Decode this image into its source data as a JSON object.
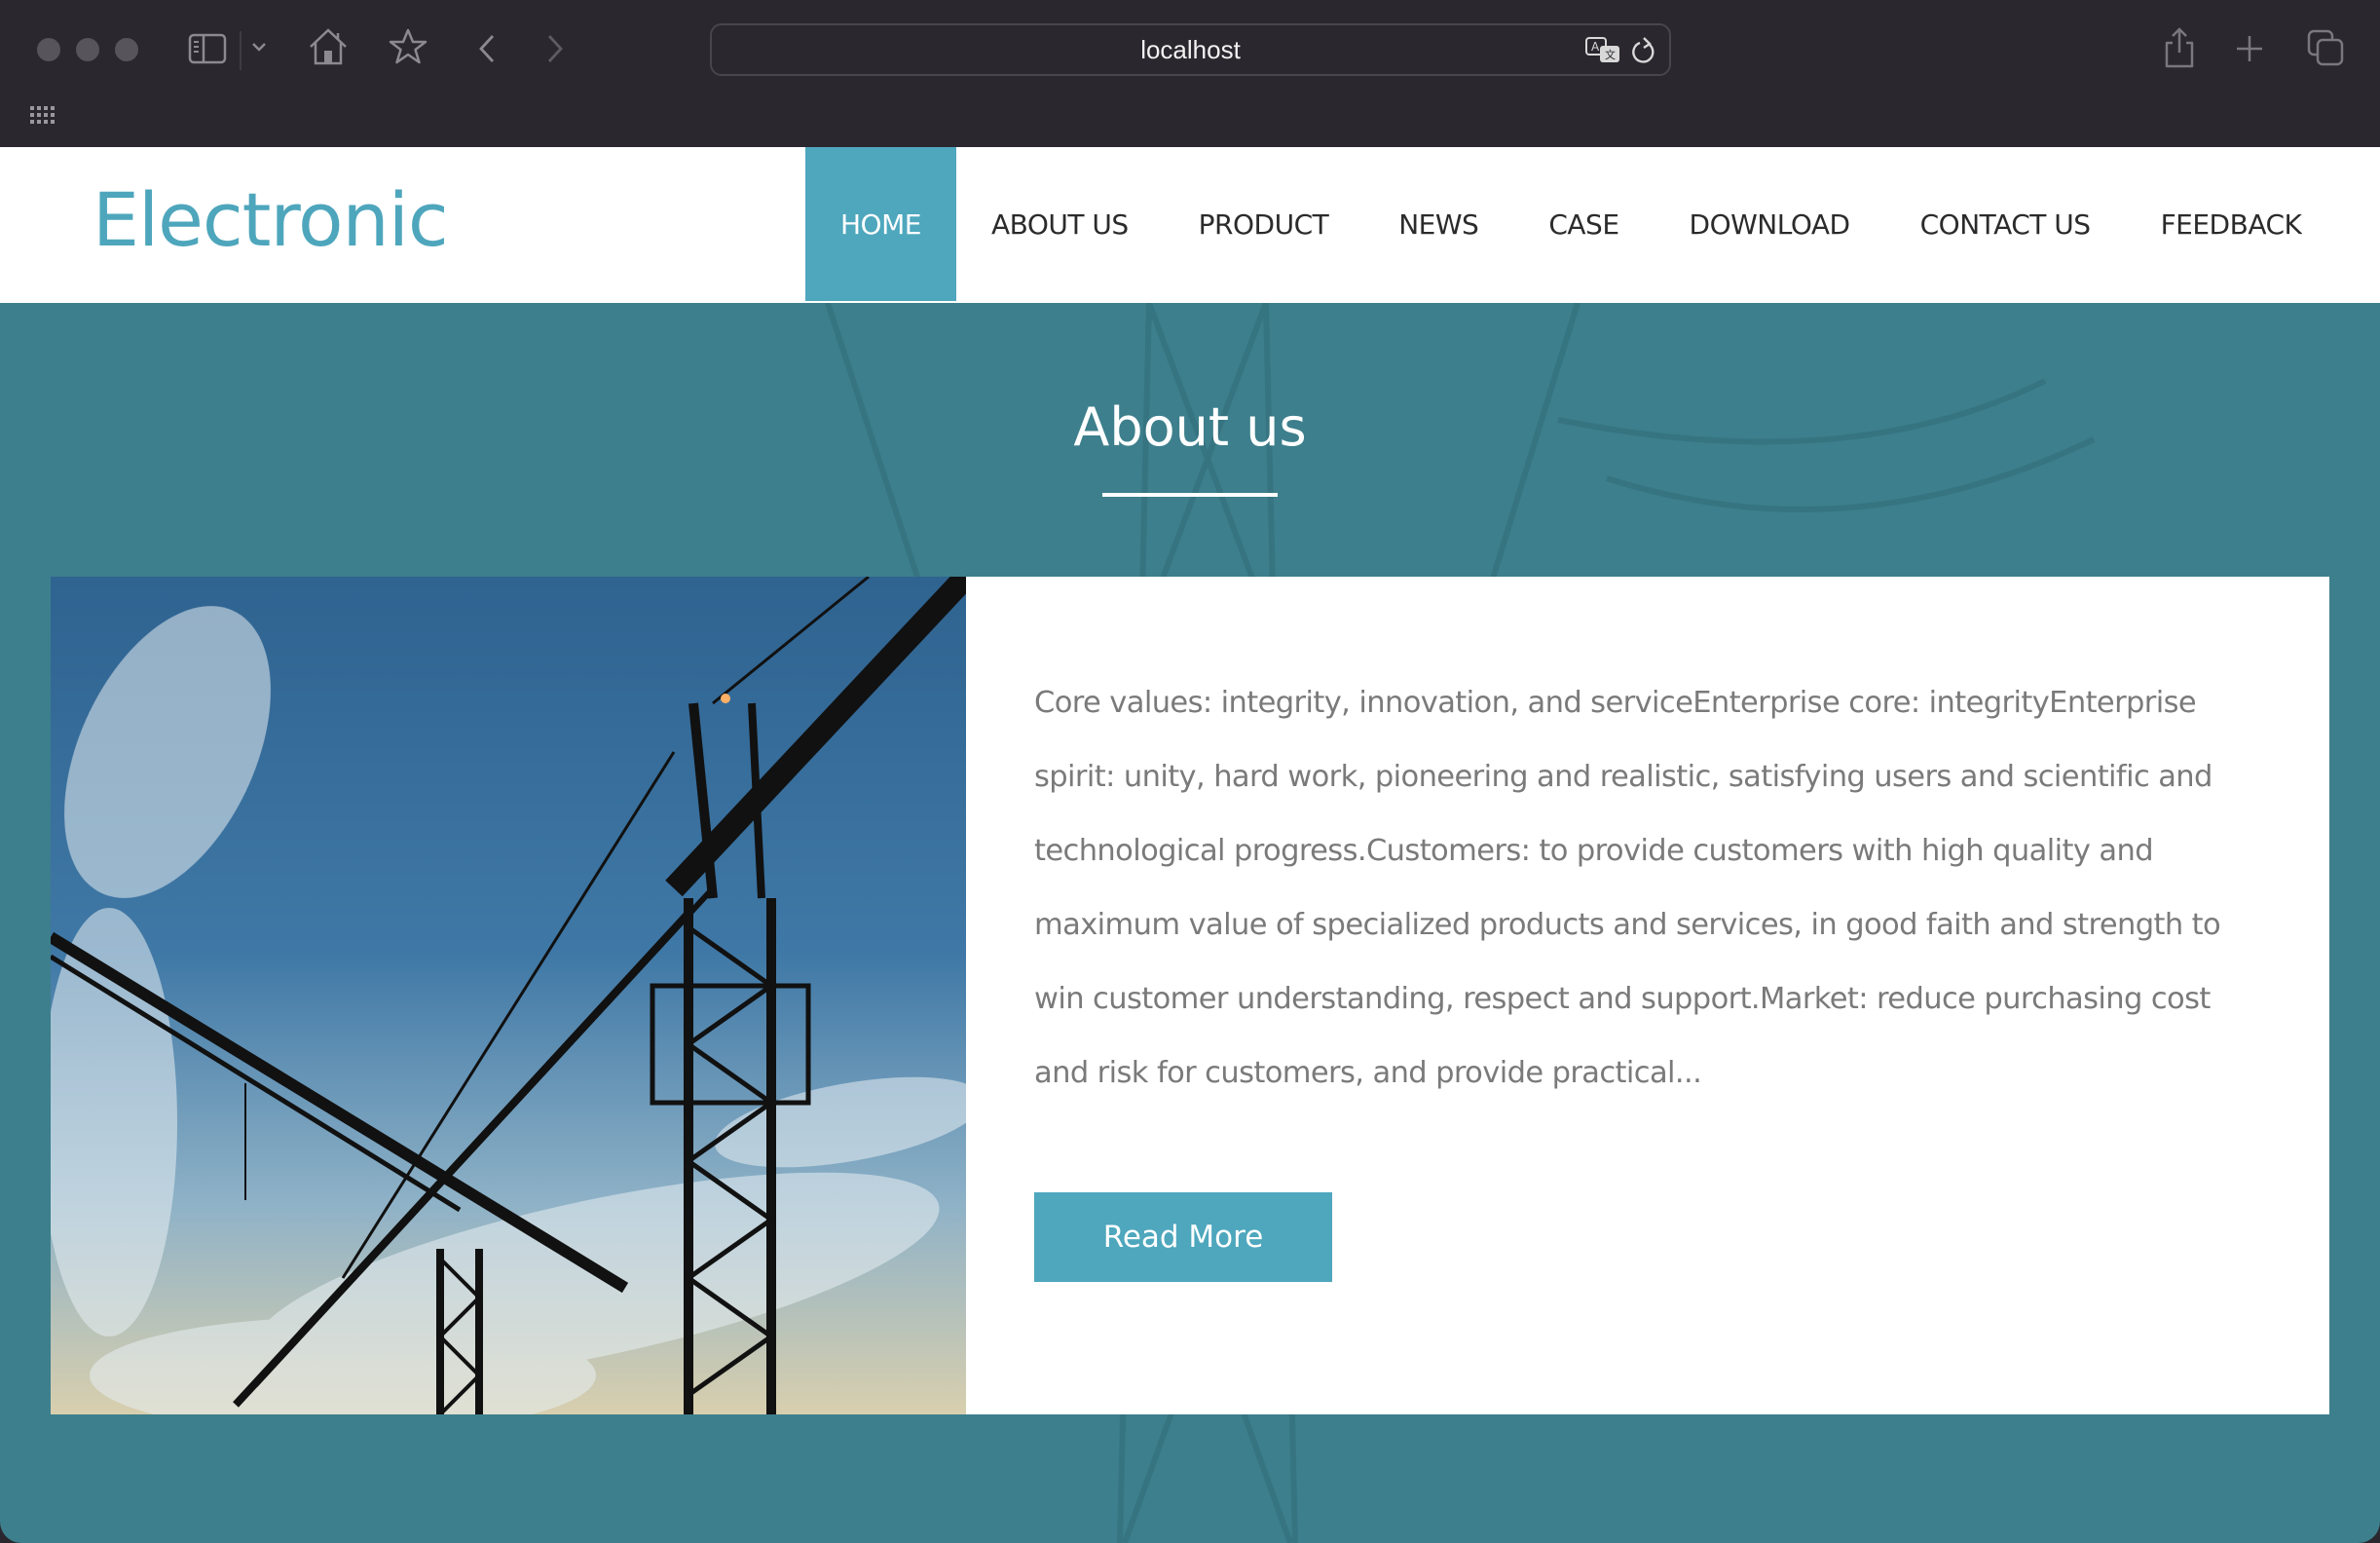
{
  "browser": {
    "url": "localhost",
    "icons": [
      "sidebar-icon",
      "chevron-down-icon",
      "home-icon",
      "star-icon",
      "back-icon",
      "forward-icon",
      "translate-icon",
      "reload-icon",
      "share-icon",
      "new-tab-icon",
      "tabs-overview-icon",
      "apps-grid-icon"
    ]
  },
  "header": {
    "logo": "Electronic",
    "nav": [
      {
        "label": "HOME",
        "active": true
      },
      {
        "label": "ABOUT US",
        "active": false
      },
      {
        "label": "PRODUCT",
        "active": false
      },
      {
        "label": "NEWS",
        "active": false
      },
      {
        "label": "CASE",
        "active": false
      },
      {
        "label": "DOWNLOAD",
        "active": false
      },
      {
        "label": "CONTACT US",
        "active": false
      },
      {
        "label": "FEEDBACK",
        "active": false
      }
    ]
  },
  "about": {
    "title": "About us",
    "image_alt": "tower cranes against blue sky",
    "text": "Core values: integrity, innovation, and serviceEnterprise core: integrityEnterprise spirit: unity, hard work, pioneering and realistic, satisfying users and scientific and technological progress.Customers: to provide customers with high quality and maximum value of specialized products and services, in good faith and strength to win customer understanding, respect and support.Market: reduce purchasing cost and risk for customers, and provide practical...",
    "button": "Read More"
  },
  "colors": {
    "accent": "#4ea7bd",
    "logo": "#4ea6bc",
    "section_bg": "#3d7f8c",
    "body_text": "#7a7a7a",
    "chrome_bg": "#2a272e"
  }
}
